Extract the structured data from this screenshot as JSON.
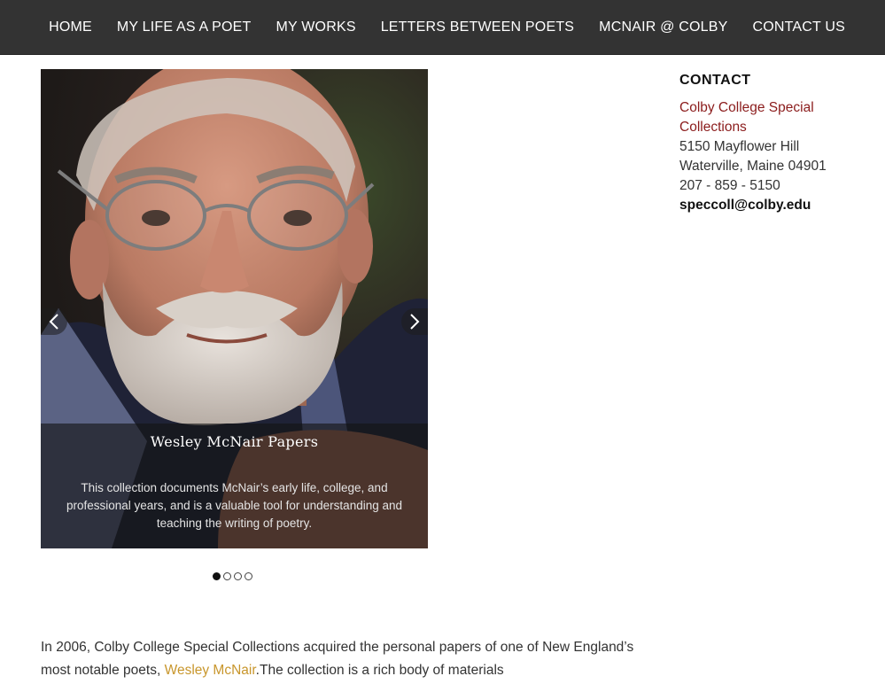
{
  "nav": {
    "items": [
      "HOME",
      "MY LIFE AS A POET",
      "MY WORKS",
      "LETTERS BETWEEN POETS",
      "MCNAIR @ COLBY",
      "CONTACT US"
    ]
  },
  "slider": {
    "caption_title": "Wesley McNair Papers",
    "caption_text": "This collection documents McNair’s early life, college, and professional years, and is a valuable tool for understanding and teaching the writing of poetry.",
    "slide_count": 4,
    "active_slide": 1
  },
  "contact": {
    "heading": "CONTACT",
    "org_line1": "Colby College Special",
    "org_line2": "Collections",
    "address1": "5150 Mayflower Hill",
    "address2": "Waterville, Maine 04901",
    "phone": "207 - 859 - 5150",
    "email": "speccoll@colby.edu"
  },
  "intro": {
    "text_before": "In 2006, Colby College Special Collections acquired the personal papers of one of New England’s most notable poets, ",
    "link_text": "Wesley McNair",
    "text_after": ".The collection is a rich body of materials"
  },
  "colors": {
    "nav_bg": "#333333",
    "org_link": "#8b1c1c",
    "name_link": "#c8962c"
  },
  "icons": {
    "prev": "chevron-left-icon",
    "next": "chevron-right-icon"
  }
}
